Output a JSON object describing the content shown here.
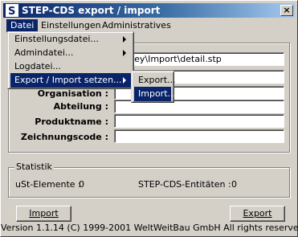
{
  "window": {
    "title": "STEP-CDS export / import",
    "close_glyph": "×"
  },
  "menubar": {
    "items": [
      "Datei",
      "Einstellungen",
      "Administratives"
    ]
  },
  "form": {
    "fields": [
      {
        "label": "",
        "value": "entley\\Import\\detail.stp"
      },
      {
        "label": "",
        "value": ""
      },
      {
        "label": "Organisation :",
        "value": ""
      },
      {
        "label": "Abteilung :",
        "value": ""
      },
      {
        "label": "Produktname :",
        "value": ""
      },
      {
        "label": "Zeichnungscode :",
        "value": ""
      }
    ]
  },
  "statistik": {
    "title": "Statistik",
    "ust_label": "uSt-Elemente :",
    "ust_value": "0",
    "cds_label": "STEP-CDS-Entitäten :",
    "cds_value": "0"
  },
  "buttons": {
    "import_label": "Import",
    "export_label": "Export"
  },
  "footer": {
    "text": "Version 1.1.14  (C) 1999-2001 WeltWeitBau GmbH All rights reserved"
  },
  "datei_menu": {
    "items": [
      {
        "label": "Einstellungsdatei...",
        "has_submenu": true
      },
      {
        "label": "Admindatei...",
        "has_submenu": true
      },
      {
        "label": "Logdatei...",
        "has_submenu": false
      },
      {
        "label": "Export / Import setzen...",
        "has_submenu": true
      }
    ]
  },
  "sub_menu": {
    "items": [
      "Export...",
      "Import..."
    ]
  },
  "colors": {
    "highlight": "#0a246a",
    "face": "#d4d0c8",
    "title_start": "#0a246a",
    "title_end": "#a6caf0"
  }
}
